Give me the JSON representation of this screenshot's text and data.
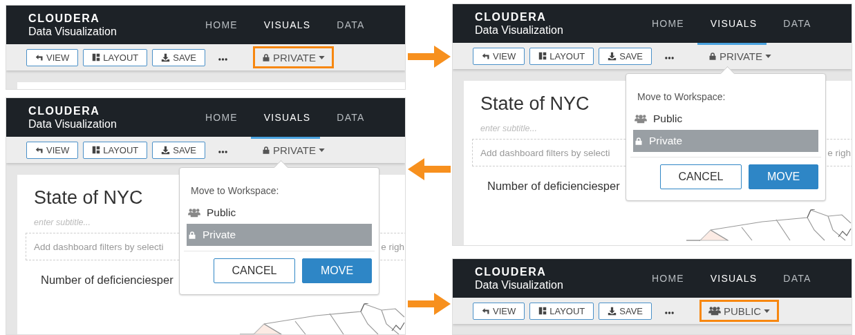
{
  "panels": [
    {
      "logo": "CLOUDERA",
      "product": "Data Visualization",
      "nav": [
        {
          "label": "HOME",
          "selected": false
        },
        {
          "label": "VISUALS",
          "selected": true
        },
        {
          "label": "DATA",
          "selected": false
        }
      ],
      "toolbar": [
        {
          "label": "VIEW"
        },
        {
          "label": "LAYOUT"
        },
        {
          "label": "SAVE"
        }
      ],
      "workspace": {
        "label": "PRIVATE",
        "kind": "private",
        "highlighted": true
      }
    },
    {
      "logo": "CLOUDERA",
      "product": "Data Visualization",
      "nav": [
        {
          "label": "HOME",
          "selected": false
        },
        {
          "label": "VISUALS",
          "selected": true
        },
        {
          "label": "DATA",
          "selected": false
        }
      ],
      "toolbar": [
        {
          "label": "VIEW"
        },
        {
          "label": "LAYOUT"
        },
        {
          "label": "SAVE"
        }
      ],
      "workspace": {
        "label": "PRIVATE",
        "kind": "private",
        "highlighted": false
      },
      "dashboard": {
        "title": "State of NYC",
        "subtitle": {
          "placeholder": "enter subtitle..."
        },
        "filter_hint_left": "Add dashboard filters by selecti",
        "filter_hint_right": "e righ",
        "chart_title": "Number of deficienciesper"
      },
      "popup": {
        "heading": "Move to Workspace:",
        "options": [
          {
            "label": "Public",
            "kind": "public",
            "selected": false
          },
          {
            "label": "Private",
            "kind": "private",
            "selected": true
          }
        ],
        "buttons": [
          {
            "label": "CANCEL",
            "kind": "secondary"
          },
          {
            "label": "MOVE",
            "kind": "primary"
          }
        ]
      }
    },
    {
      "logo": "CLOUDERA",
      "product": "Data Visualization",
      "nav": [
        {
          "label": "HOME",
          "selected": false
        },
        {
          "label": "VISUALS",
          "selected": true
        },
        {
          "label": "DATA",
          "selected": false
        }
      ],
      "toolbar": [
        {
          "label": "VIEW"
        },
        {
          "label": "LAYOUT"
        },
        {
          "label": "SAVE"
        }
      ],
      "workspace": {
        "label": "PRIVATE",
        "kind": "private",
        "highlighted": false
      },
      "dashboard": {
        "title": "State of NYC",
        "subtitle": {
          "placeholder": "enter subtitle..."
        },
        "filter_hint_left": "Add dashboard filters by selecti",
        "filter_hint_right": "e righ",
        "chart_title": "Number of deficienciesper"
      },
      "popup": {
        "heading": "Move to Workspace:",
        "options": [
          {
            "label": "Public",
            "kind": "public",
            "selected": false
          },
          {
            "label": "Private",
            "kind": "private",
            "selected": true
          }
        ],
        "buttons": [
          {
            "label": "CANCEL",
            "kind": "secondary"
          },
          {
            "label": "MOVE",
            "kind": "primary"
          }
        ]
      }
    },
    {
      "logo": "CLOUDERA",
      "product": "Data Visualization",
      "nav": [
        {
          "label": "HOME",
          "selected": false
        },
        {
          "label": "VISUALS",
          "selected": true
        },
        {
          "label": "DATA",
          "selected": false
        }
      ],
      "toolbar": [
        {
          "label": "VIEW"
        },
        {
          "label": "LAYOUT"
        },
        {
          "label": "SAVE"
        }
      ],
      "workspace": {
        "label": "PUBLIC",
        "kind": "public",
        "highlighted": true
      }
    }
  ],
  "arrows": [
    {
      "kind": "right"
    },
    {
      "kind": "left"
    },
    {
      "kind": "right"
    }
  ]
}
